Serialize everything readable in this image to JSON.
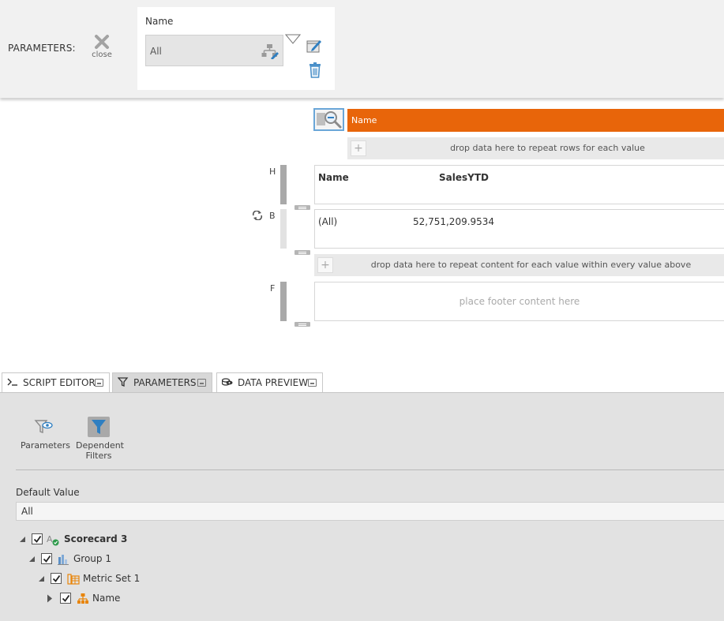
{
  "param_bar": {
    "title": "PARAMETERS:",
    "close_label": "close",
    "param_name": "Name",
    "param_value": "All"
  },
  "designer": {
    "group_header": "Name",
    "drop_rows_text": "drop data here to repeat rows for each value",
    "drop_content_text": "drop data here to repeat content for each value within every value above",
    "footer_placeholder": "place footer content here",
    "bands": {
      "header_letter": "H",
      "body_letter": "B",
      "footer_letter": "F"
    },
    "columns": [
      "Name",
      "SalesYTD"
    ],
    "rows": [
      [
        "(All)",
        "52,751,209.9534"
      ]
    ]
  },
  "tabs": [
    {
      "label": "SCRIPT EDITOR",
      "icon": "terminal-icon"
    },
    {
      "label": "PARAMETERS",
      "icon": "filter-icon"
    },
    {
      "label": "DATA PREVIEW",
      "icon": "data-preview-icon"
    }
  ],
  "panel": {
    "tool_parameters": "Parameters",
    "tool_dependent_line1": "Dependent",
    "tool_dependent_line2": "Filters",
    "default_value_label": "Default Value",
    "default_value": "All",
    "tree": [
      {
        "label": "Scorecard 3",
        "bold": true,
        "icon": "scorecard-icon"
      },
      {
        "label": "Group 1",
        "bold": false,
        "icon": "group-bar-icon"
      },
      {
        "label": "Metric Set 1",
        "bold": false,
        "icon": "metric-set-icon"
      },
      {
        "label": "Name",
        "bold": false,
        "icon": "hierarchy-icon"
      }
    ]
  },
  "colors": {
    "accent_orange": "#e8650a",
    "selection_blue": "#6aa6d8",
    "panel_bg": "#e2e2e2"
  }
}
